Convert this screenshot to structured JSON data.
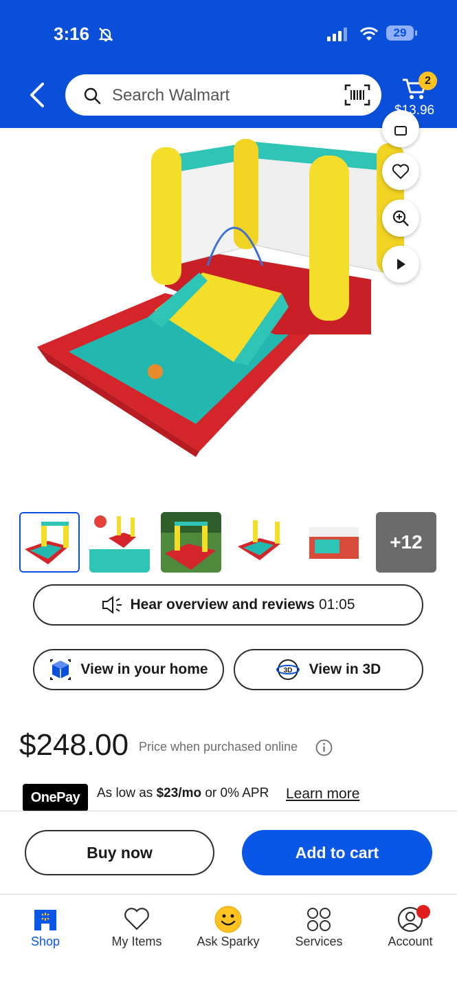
{
  "status_bar": {
    "time": "3:16",
    "battery": "29"
  },
  "header": {
    "search_placeholder": "Search Walmart",
    "cart_count": "2",
    "cart_total": "$13.96",
    "icons": [
      "back-arrow-icon",
      "search-icon",
      "barcode-scanner-icon",
      "cart-icon"
    ]
  },
  "gallery": {
    "more_count": "+12",
    "thumbnails": 6
  },
  "actions": {
    "hear_label": "Hear overview and reviews",
    "hear_duration": "01:05",
    "view_home": "View in your home",
    "view_3d": "View in 3D"
  },
  "product": {
    "price": "$248.00",
    "price_note": "Price when purchased online"
  },
  "onepay": {
    "logo": "OnePay",
    "prefix": "As low as ",
    "amount": "$23/mo",
    "suffix": " or 0% APR",
    "learn_more": "Learn more"
  },
  "cta": {
    "buy_now": "Buy now",
    "add_to_cart": "Add to cart"
  },
  "tabbar": [
    {
      "label": "Shop",
      "icon": "shop-icon",
      "active": true
    },
    {
      "label": "My Items",
      "icon": "heart-icon"
    },
    {
      "label": "Ask Sparky",
      "icon": "sparky-face-icon"
    },
    {
      "label": "Services",
      "icon": "services-grid-icon"
    },
    {
      "label": "Account",
      "icon": "account-icon"
    }
  ],
  "colors": {
    "brand_blue": "#0a4fd9",
    "cta_blue": "#0a56e6",
    "badge_yellow": "#ffc220",
    "notify_red": "#e01e1e"
  }
}
